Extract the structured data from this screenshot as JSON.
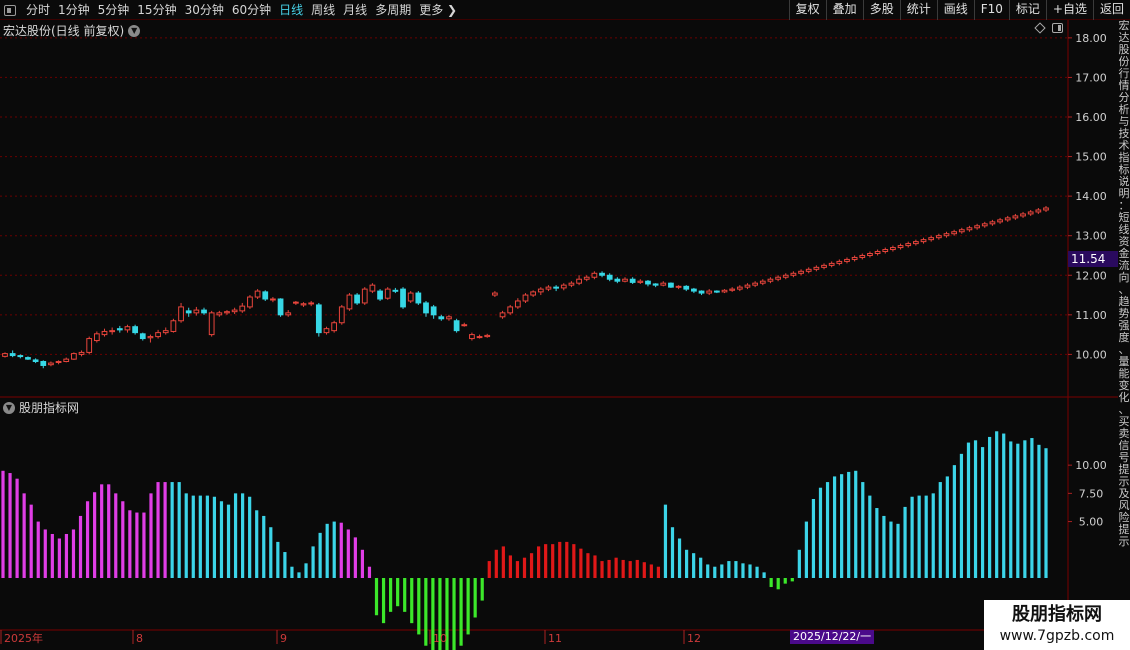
{
  "toolbar": {
    "periods": [
      "分时",
      "1分钟",
      "5分钟",
      "15分钟",
      "30分钟",
      "60分钟",
      "日线",
      "周线",
      "月线",
      "多周期",
      "更多"
    ],
    "active_period": "日线",
    "right_buttons": [
      "复权",
      "叠加",
      "多股",
      "统计",
      "画线",
      "F10",
      "标记",
      "+自选",
      "返回"
    ]
  },
  "stock": {
    "title": "宏达股份(日线 前复权)",
    "current_price": "11.54"
  },
  "indicator": {
    "title": "股朋指标网"
  },
  "axis": {
    "price_ticks": [
      "18.00",
      "17.00",
      "16.00",
      "15.00",
      "14.00",
      "13.00",
      "12.00",
      "11.00",
      "10.00"
    ],
    "indicator_ticks": [
      "10.00",
      "7.50",
      "5.00"
    ],
    "date_labels": [
      "2025年",
      "8",
      "9",
      "10",
      "11",
      "12"
    ],
    "cursor_date": "2025/12/22/一"
  },
  "right_strip_text": "宏达股份行情分析与技术指标说明：短线资金流向、趋势强度、量能变化、买卖信号提示及风险提示",
  "watermark": {
    "title": "股朋指标网",
    "url": "www.7gpzb.com"
  },
  "colors": {
    "up": "#e8453c",
    "down": "#37d8e6",
    "bar_magenta": "#e03ee6",
    "bar_cyan": "#3cd4e8",
    "bar_green": "#3ce82a",
    "bar_red": "#e01818",
    "grid": "#6a0000",
    "axis_text": "#d0d0d0"
  },
  "chart_data": [
    {
      "type": "candlestick",
      "name": "宏达股份",
      "ylim": [
        9.1,
        18.3
      ],
      "candles": [
        [
          9.95,
          10.02,
          9.92,
          10.05
        ],
        [
          10.02,
          9.97,
          9.93,
          10.1
        ],
        [
          9.97,
          9.95,
          9.9,
          10.0
        ],
        [
          9.92,
          9.88,
          9.86,
          9.95
        ],
        [
          9.86,
          9.82,
          9.78,
          9.9
        ],
        [
          9.82,
          9.72,
          9.65,
          9.85
        ],
        [
          9.74,
          9.78,
          9.7,
          9.82
        ],
        [
          9.8,
          9.82,
          9.75,
          9.85
        ],
        [
          9.82,
          9.88,
          9.8,
          9.92
        ],
        [
          9.88,
          10.02,
          9.86,
          10.05
        ],
        [
          10.0,
          10.05,
          9.95,
          10.1
        ],
        [
          10.05,
          10.4,
          10.0,
          10.45
        ],
        [
          10.35,
          10.52,
          10.3,
          10.58
        ],
        [
          10.5,
          10.58,
          10.45,
          10.65
        ],
        [
          10.58,
          10.6,
          10.5,
          10.68
        ],
        [
          10.65,
          10.62,
          10.55,
          10.72
        ],
        [
          10.62,
          10.7,
          10.55,
          10.75
        ],
        [
          10.7,
          10.55,
          10.5,
          10.75
        ],
        [
          10.52,
          10.4,
          10.35,
          10.55
        ],
        [
          10.42,
          10.45,
          10.3,
          10.5
        ],
        [
          10.45,
          10.55,
          10.4,
          10.62
        ],
        [
          10.55,
          10.6,
          10.5,
          10.68
        ],
        [
          10.58,
          10.85,
          10.55,
          10.9
        ],
        [
          10.85,
          11.2,
          10.8,
          11.3
        ],
        [
          11.1,
          11.05,
          10.95,
          11.18
        ],
        [
          11.05,
          11.12,
          10.98,
          11.2
        ],
        [
          11.12,
          11.05,
          11.0,
          11.18
        ],
        [
          10.5,
          11.05,
          10.45,
          11.1
        ],
        [
          11.0,
          11.05,
          10.95,
          11.1
        ],
        [
          11.05,
          11.08,
          11.0,
          11.12
        ],
        [
          11.08,
          11.12,
          11.02,
          11.18
        ],
        [
          11.1,
          11.22,
          11.05,
          11.3
        ],
        [
          11.2,
          11.45,
          11.15,
          11.5
        ],
        [
          11.45,
          11.6,
          11.4,
          11.65
        ],
        [
          11.58,
          11.4,
          11.35,
          11.62
        ],
        [
          11.38,
          11.4,
          11.32,
          11.45
        ],
        [
          11.4,
          11.0,
          10.95,
          11.42
        ],
        [
          11.0,
          11.05,
          10.95,
          11.12
        ],
        [
          11.3,
          11.32,
          11.25,
          11.35
        ],
        [
          11.25,
          11.28,
          11.2,
          11.32
        ],
        [
          11.28,
          11.3,
          11.22,
          11.35
        ],
        [
          11.25,
          10.55,
          10.45,
          11.3
        ],
        [
          10.55,
          10.65,
          10.5,
          10.7
        ],
        [
          10.6,
          10.8,
          10.55,
          10.85
        ],
        [
          10.8,
          11.2,
          10.75,
          11.25
        ],
        [
          11.15,
          11.5,
          11.1,
          11.55
        ],
        [
          11.5,
          11.3,
          11.25,
          11.55
        ],
        [
          11.3,
          11.65,
          11.25,
          11.7
        ],
        [
          11.6,
          11.75,
          11.55,
          11.8
        ],
        [
          11.6,
          11.4,
          11.35,
          11.65
        ],
        [
          11.42,
          11.65,
          11.38,
          11.7
        ],
        [
          11.62,
          11.6,
          11.55,
          11.68
        ],
        [
          11.65,
          11.2,
          11.15,
          11.7
        ],
        [
          11.35,
          11.55,
          11.3,
          11.6
        ],
        [
          11.55,
          11.3,
          11.25,
          11.6
        ],
        [
          11.3,
          11.05,
          10.95,
          11.35
        ],
        [
          11.2,
          11.0,
          10.9,
          11.25
        ],
        [
          10.95,
          10.9,
          10.85,
          11.0
        ],
        [
          10.9,
          10.95,
          10.85,
          11.0
        ],
        [
          10.85,
          10.6,
          10.55,
          10.9
        ],
        [
          10.75,
          10.75,
          10.7,
          10.8
        ],
        [
          10.4,
          10.5,
          10.35,
          10.55
        ],
        [
          10.45,
          10.45,
          10.4,
          10.5
        ],
        [
          10.45,
          10.48,
          10.42,
          10.52
        ],
        [
          11.5,
          11.55,
          11.45,
          11.6
        ],
        [
          10.95,
          11.05,
          10.9,
          11.1
        ],
        [
          11.05,
          11.2,
          11.0,
          11.25
        ],
        [
          11.2,
          11.35,
          11.15,
          11.42
        ],
        [
          11.35,
          11.5,
          11.3,
          11.55
        ],
        [
          11.5,
          11.58,
          11.45,
          11.62
        ],
        [
          11.58,
          11.65,
          11.5,
          11.7
        ],
        [
          11.65,
          11.7,
          11.6,
          11.75
        ],
        [
          11.7,
          11.68,
          11.6,
          11.75
        ],
        [
          11.68,
          11.75,
          11.62,
          11.8
        ],
        [
          11.75,
          11.8,
          11.7,
          11.85
        ],
        [
          11.8,
          11.9,
          11.75,
          12.0
        ],
        [
          11.9,
          11.95,
          11.85,
          12.0
        ],
        [
          11.95,
          12.05,
          11.9,
          12.1
        ],
        [
          12.05,
          12.0,
          11.95,
          12.1
        ],
        [
          12.0,
          11.9,
          11.85,
          12.05
        ],
        [
          11.9,
          11.85,
          11.8,
          11.95
        ],
        [
          11.85,
          11.9,
          11.82,
          11.95
        ],
        [
          11.9,
          11.82,
          11.78,
          11.95
        ],
        [
          11.82,
          11.85,
          11.78,
          11.9
        ],
        [
          11.85,
          11.78,
          11.72,
          11.88
        ],
        [
          11.78,
          11.75,
          11.7,
          11.8
        ],
        [
          11.75,
          11.8,
          11.72,
          11.85
        ],
        [
          11.8,
          11.7,
          11.68,
          11.82
        ],
        [
          11.7,
          11.72,
          11.65,
          11.75
        ],
        [
          11.72,
          11.65,
          11.6,
          11.75
        ],
        [
          11.65,
          11.6,
          11.55,
          11.68
        ],
        [
          11.6,
          11.55,
          11.5,
          11.62
        ],
        [
          11.55,
          11.6,
          11.5,
          11.65
        ],
        [
          11.6,
          11.58,
          11.55,
          11.62
        ],
        [
          11.58,
          11.62,
          11.55,
          11.65
        ],
        [
          11.62,
          11.65,
          11.58,
          11.7
        ],
        [
          11.65,
          11.7,
          11.6,
          11.75
        ],
        [
          11.7,
          11.75,
          11.65,
          11.8
        ],
        [
          11.75,
          11.8,
          11.7,
          11.85
        ],
        [
          11.8,
          11.85,
          11.75,
          11.9
        ],
        [
          11.85,
          11.9,
          11.8,
          11.95
        ],
        [
          11.9,
          11.95,
          11.85,
          12.0
        ],
        [
          11.95,
          12.0,
          11.9,
          12.05
        ],
        [
          12.0,
          12.05,
          11.95,
          12.1
        ],
        [
          12.05,
          12.1,
          12.0,
          12.15
        ],
        [
          12.1,
          12.15,
          12.05,
          12.2
        ],
        [
          12.15,
          12.2,
          12.1,
          12.25
        ],
        [
          12.2,
          12.25,
          12.15,
          12.3
        ],
        [
          12.25,
          12.3,
          12.2,
          12.35
        ],
        [
          12.3,
          12.35,
          12.25,
          12.4
        ],
        [
          12.35,
          12.4,
          12.3,
          12.45
        ],
        [
          12.4,
          12.45,
          12.35,
          12.5
        ],
        [
          12.45,
          12.5,
          12.4,
          12.55
        ],
        [
          12.5,
          12.55,
          12.45,
          12.6
        ],
        [
          12.55,
          12.6,
          12.5,
          12.65
        ],
        [
          12.6,
          12.65,
          12.55,
          12.7
        ],
        [
          12.65,
          12.7,
          12.6,
          12.75
        ],
        [
          12.7,
          12.75,
          12.65,
          12.8
        ],
        [
          12.75,
          12.8,
          12.7,
          12.85
        ],
        [
          12.8,
          12.85,
          12.75,
          12.9
        ],
        [
          12.85,
          12.9,
          12.8,
          12.95
        ],
        [
          12.9,
          12.95,
          12.85,
          13.0
        ],
        [
          12.95,
          13.0,
          12.9,
          13.05
        ],
        [
          13.0,
          13.05,
          12.95,
          13.1
        ],
        [
          13.05,
          13.1,
          13.0,
          13.15
        ],
        [
          13.1,
          13.15,
          13.05,
          13.2
        ],
        [
          13.15,
          13.2,
          13.1,
          13.25
        ],
        [
          13.2,
          13.25,
          13.15,
          13.3
        ],
        [
          13.25,
          13.3,
          13.2,
          13.35
        ],
        [
          13.3,
          13.35,
          13.25,
          13.4
        ],
        [
          13.35,
          13.4,
          13.3,
          13.45
        ],
        [
          13.4,
          13.45,
          13.35,
          13.5
        ],
        [
          13.45,
          13.5,
          13.4,
          13.55
        ],
        [
          13.5,
          13.55,
          13.45,
          13.6
        ],
        [
          13.55,
          13.6,
          13.5,
          13.65
        ],
        [
          13.6,
          13.65,
          13.55,
          13.7
        ],
        [
          13.65,
          13.7,
          13.6,
          13.75
        ]
      ]
    },
    {
      "type": "bar",
      "name": "股朋指标网",
      "ylim": [
        0,
        14
      ],
      "series": [
        {
          "color": "magenta",
          "values": [
            9.5,
            9.3,
            8.8,
            7.5,
            6.5,
            5.0,
            4.3,
            3.9,
            3.5,
            3.9,
            4.3,
            5.5,
            6.8,
            7.6,
            8.3,
            8.3,
            7.5,
            6.8,
            6.0,
            5.8,
            5.8,
            7.5,
            8.5,
            8.5
          ]
        },
        {
          "color": "cyan",
          "values": [
            8.5,
            8.5,
            7.5,
            7.3,
            7.3,
            7.3,
            7.2,
            6.8,
            6.5,
            7.5,
            7.5,
            7.2,
            6.0,
            5.5,
            4.5,
            3.2,
            2.3,
            1.0,
            0.5,
            1.3,
            2.8,
            4.0,
            4.8,
            5.0
          ]
        },
        {
          "color": "magenta",
          "values": [
            4.9,
            4.3,
            3.6,
            2.5,
            1.0
          ]
        },
        {
          "color": "green",
          "values": [
            -3.3,
            -4.0,
            -3.0,
            -2.5,
            -3.0,
            -4.0,
            -5.0,
            -6.0,
            -6.5,
            -7.5,
            -8.0,
            -7.5,
            -6.0,
            -5.0,
            -3.5,
            -2.0
          ]
        },
        {
          "color": "red",
          "values": [
            1.5,
            2.5,
            2.8,
            2.0,
            1.5,
            1.8,
            2.2,
            2.8,
            3.0,
            3.0,
            3.2,
            3.2,
            3.0,
            2.6,
            2.2,
            2.0,
            1.5,
            1.6,
            1.8,
            1.6,
            1.5,
            1.6,
            1.4,
            1.2,
            1.0
          ]
        },
        {
          "color": "cyan",
          "values": [
            6.5,
            4.5,
            3.5,
            2.5,
            2.2,
            1.8,
            1.2,
            1.0,
            1.2,
            1.5,
            1.5,
            1.3,
            1.2,
            1.0,
            0.5
          ]
        },
        {
          "color": "green",
          "values": [
            -0.8,
            -1.0,
            -0.5,
            -0.3
          ]
        },
        {
          "color": "cyan",
          "values": [
            2.5,
            5.0,
            7.0,
            8.0,
            8.5,
            9.0,
            9.2,
            9.4,
            9.5,
            8.5,
            7.3,
            6.2,
            5.5,
            5.0,
            4.8,
            6.3,
            7.2,
            7.3,
            7.3,
            7.5,
            8.5,
            9.0,
            10.0,
            11.0,
            12.0,
            12.2,
            11.6,
            12.5,
            13.0,
            12.8,
            12.1,
            11.9,
            12.2,
            12.4,
            11.8,
            11.5
          ]
        }
      ]
    }
  ]
}
